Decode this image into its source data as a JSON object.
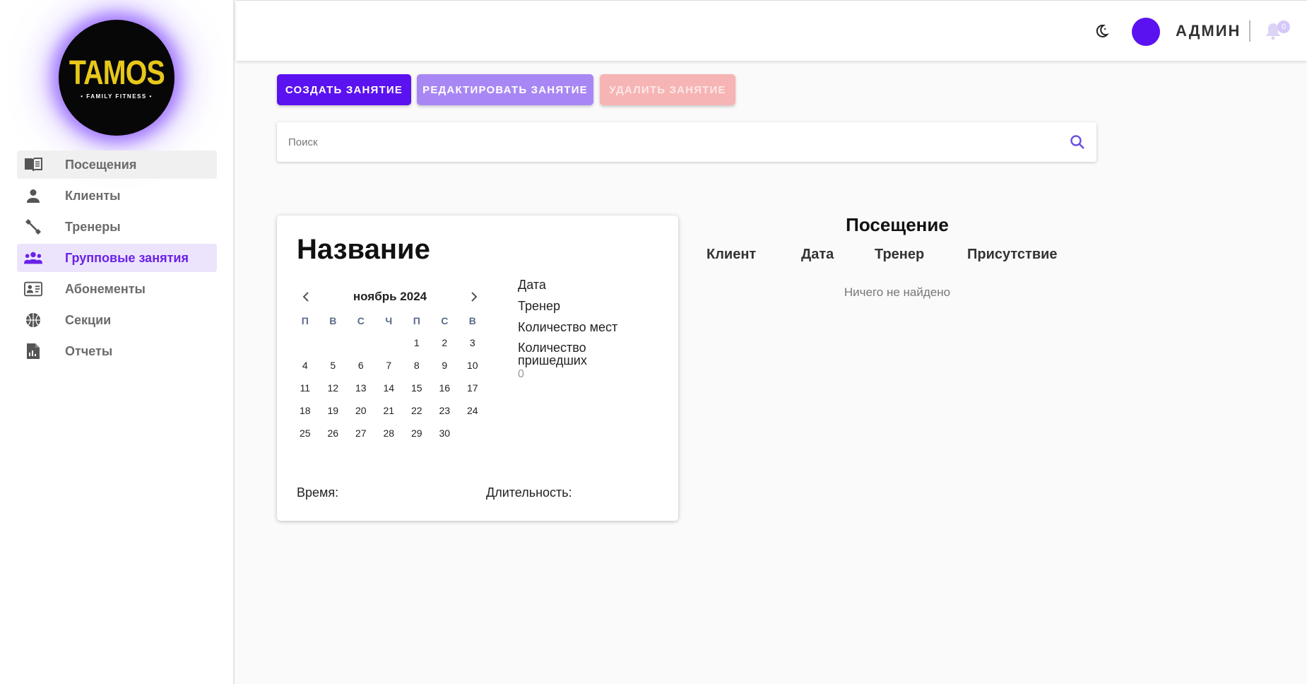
{
  "brand": {
    "logo_main": "TAMOS",
    "logo_sub": "• FAMILY FITNESS •"
  },
  "sidebar": {
    "items": [
      {
        "label": "Посещения",
        "icon": "book-icon",
        "state": "hover"
      },
      {
        "label": "Клиенты",
        "icon": "person-icon",
        "state": ""
      },
      {
        "label": "Тренеры",
        "icon": "dumbbell-icon",
        "state": ""
      },
      {
        "label": "Групповые занятия",
        "icon": "group-icon",
        "state": "active"
      },
      {
        "label": "Абонементы",
        "icon": "id-card-icon",
        "state": ""
      },
      {
        "label": "Секции",
        "icon": "basketball-icon",
        "state": ""
      },
      {
        "label": "Отчеты",
        "icon": "report-icon",
        "state": ""
      }
    ]
  },
  "header": {
    "user_name": "АДМИН",
    "notification_count": "0"
  },
  "toolbar": {
    "create_label": "СОЗДАТЬ ЗАНЯТИЕ",
    "edit_label": "РЕДАКТИРОВАТЬ ЗАНЯТИЕ",
    "delete_label": "УДАЛИТЬ ЗАНЯТИЕ"
  },
  "search": {
    "placeholder": "Поиск",
    "value": ""
  },
  "card": {
    "title": "Название",
    "calendar": {
      "month": "ноябрь 2024",
      "weekdays": [
        "П",
        "В",
        "С",
        "Ч",
        "П",
        "С",
        "В"
      ],
      "leading_blanks": 4,
      "days": [
        "1",
        "2",
        "3",
        "4",
        "5",
        "6",
        "7",
        "8",
        "9",
        "10",
        "11",
        "12",
        "13",
        "14",
        "15",
        "16",
        "17",
        "18",
        "19",
        "20",
        "21",
        "22",
        "23",
        "24",
        "25",
        "26",
        "27",
        "28",
        "29",
        "30"
      ]
    },
    "info": {
      "date_label": "Дата",
      "trainer_label": "Тренер",
      "seats_label": "Количество мест",
      "attendees_label": "Количество пришедших",
      "attendees_value": "0"
    },
    "time_label": "Время:",
    "duration_label": "Длительность:"
  },
  "visits": {
    "title": "Посещение",
    "columns": [
      "Клиент",
      "Дата",
      "Тренер",
      "Присутствие"
    ],
    "empty_text": "Ничего не найдено"
  },
  "colors": {
    "accent": "#5b12f0",
    "accent_light": "#a887f4",
    "danger_light": "#f7b4b4",
    "logo_yellow": "#e7c81a"
  }
}
